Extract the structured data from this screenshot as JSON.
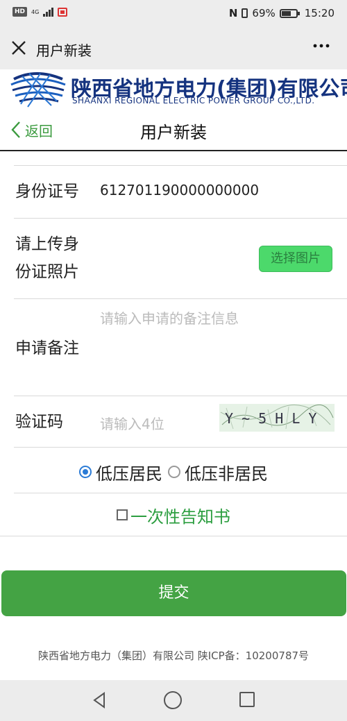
{
  "status_bar": {
    "hd": "HD",
    "network": "4G",
    "battery_percent": "69%",
    "time": "15:20",
    "icons": [
      "hd-icon",
      "signal-icon",
      "app-notification-icon",
      "nfc-icon",
      "vibrate-icon",
      "battery-icon"
    ]
  },
  "wechat": {
    "title": "用户新装",
    "close_icon": "close-icon",
    "more_icon": "more-icon"
  },
  "banner": {
    "company_cn": "陕西省地方电力(集团)有限公司",
    "company_en": "SHAANXI REGIONAL ELECTRIC POWER GROUP CO.,LTD."
  },
  "header": {
    "back_label": "返回",
    "title": "用户新装"
  },
  "form": {
    "id_label": "身份证号",
    "id_value": "612701190000000000",
    "upload_label_line1": "请上传身",
    "upload_label_line2": "份证照片",
    "upload_button": "选择图片",
    "remark_label": "申请备注",
    "remark_placeholder": "请输入申请的备注信息",
    "captcha_label": "验证码",
    "captcha_placeholder": "请输入4位",
    "captcha_text": "Y ~ 5 H L Y",
    "radio_options": [
      {
        "label": "低压居民",
        "selected": true
      },
      {
        "label": "低压非居民",
        "selected": false
      }
    ],
    "notice_checkbox": "☐",
    "notice_label": "一次性告知书",
    "submit_label": "提交"
  },
  "footer": {
    "text": "陕西省地方电力（集团）有限公司 陕ICP备：10200787号"
  },
  "colors": {
    "brand_blue": "#15337f",
    "accent_green": "#44a344",
    "link_green": "#3a9a3e",
    "upload_green": "#4cd96b",
    "radio_blue": "#2b7bd6"
  }
}
